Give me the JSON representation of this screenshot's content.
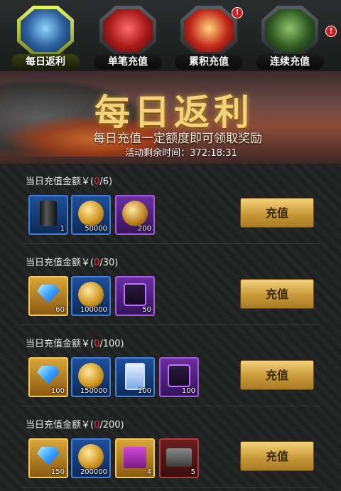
{
  "tabs": [
    {
      "label": "每日返利",
      "active": true,
      "badge": ""
    },
    {
      "label": "单笔充值",
      "active": false,
      "badge": ""
    },
    {
      "label": "累积充值",
      "active": false,
      "badge": "!"
    },
    {
      "label": "连续充值",
      "active": false,
      "badge": "!"
    }
  ],
  "banner": {
    "title": "每日返利",
    "subtitle": "每日充值一定额度即可领取奖励",
    "timer": "活动剩余时间：372:18:31"
  },
  "rows": [
    {
      "req_prefix": "当日充值金额￥(",
      "current": "0",
      "target": "/6)",
      "button": "充值",
      "items": [
        {
          "icon": "fuel-barrel-icon",
          "qty": "1",
          "frame": "blue"
        },
        {
          "icon": "gold-coin-icon",
          "qty": "50000",
          "frame": "blue"
        },
        {
          "icon": "gold-badge-icon",
          "qty": "200",
          "frame": "purple"
        }
      ]
    },
    {
      "req_prefix": "当日充值金额￥(",
      "current": "0",
      "target": "/30)",
      "button": "充值",
      "items": [
        {
          "icon": "diamond-icon",
          "qty": "60",
          "frame": "gold"
        },
        {
          "icon": "gold-coin-icon",
          "qty": "100000",
          "frame": "blue"
        },
        {
          "icon": "jet-chip-icon",
          "qty": "50",
          "frame": "purple"
        }
      ]
    },
    {
      "req_prefix": "当日充值金额￥(",
      "current": "0",
      "target": "/100)",
      "button": "充值",
      "items": [
        {
          "icon": "diamond-icon",
          "qty": "100",
          "frame": "gold"
        },
        {
          "icon": "gold-coin-icon",
          "qty": "150000",
          "frame": "blue"
        },
        {
          "icon": "upgrade-card-icon",
          "qty": "100",
          "frame": "blue"
        },
        {
          "icon": "jet-chip-icon",
          "qty": "100",
          "frame": "purple"
        }
      ]
    },
    {
      "req_prefix": "当日充值金额￥(",
      "current": "0",
      "target": "/200)",
      "button": "充值",
      "items": [
        {
          "icon": "diamond-icon",
          "qty": "150",
          "frame": "gold"
        },
        {
          "icon": "gold-coin-icon",
          "qty": "200000",
          "frame": "blue"
        },
        {
          "icon": "gift-box-icon",
          "qty": "4",
          "frame": "gold"
        },
        {
          "icon": "crate-icon",
          "qty": "5",
          "frame": "red"
        }
      ]
    }
  ]
}
